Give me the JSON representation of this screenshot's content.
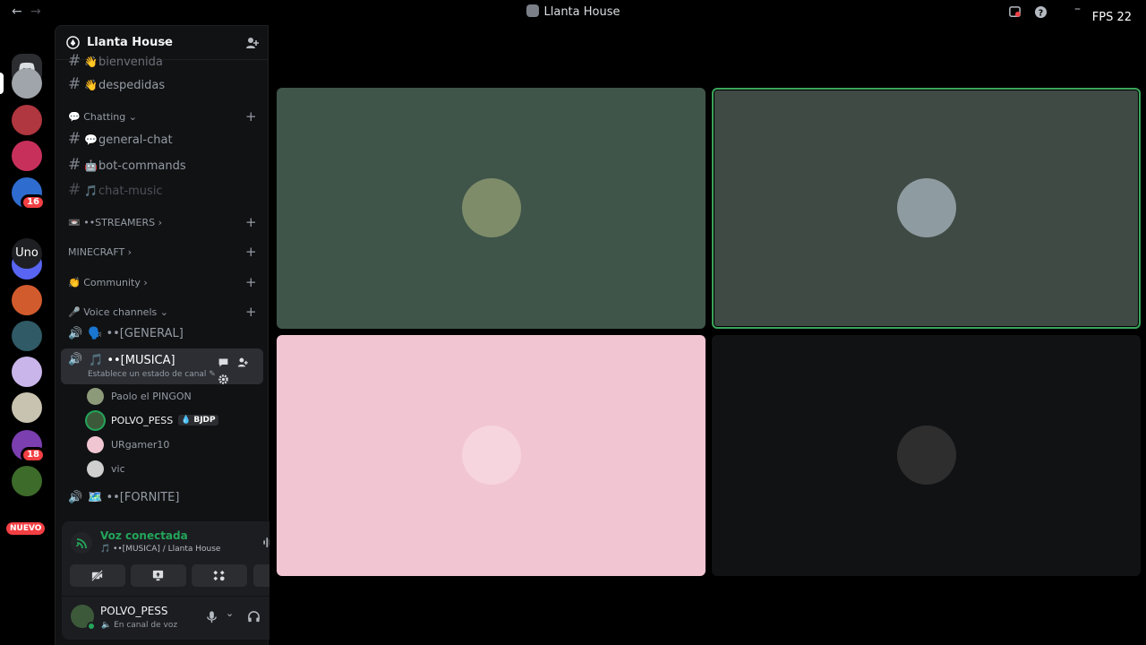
{
  "titlebar": {
    "title": "Llanta House",
    "fps": "FPS 22"
  },
  "rail": {
    "servers": [
      {
        "name": "server-1",
        "color": "#a0a4ab",
        "badge": ""
      },
      {
        "name": "server-2",
        "color": "#b0363f",
        "badge": ""
      },
      {
        "name": "server-3",
        "color": "#c8305c",
        "badge": ""
      },
      {
        "name": "server-4",
        "color": "#2f6ccf",
        "badge": "16"
      },
      {
        "name": "server-6",
        "color": "#5865f2",
        "badge": ""
      },
      {
        "name": "server-7",
        "color": "#d25b2e",
        "badge": ""
      },
      {
        "name": "server-8",
        "color": "#2f5a66",
        "badge": ""
      },
      {
        "name": "server-9",
        "color": "#c9b5ea",
        "badge": ""
      },
      {
        "name": "server-10",
        "color": "#c8c2b0",
        "badge": ""
      },
      {
        "name": "server-11",
        "color": "#7b3fb0",
        "badge": "18"
      },
      {
        "name": "server-12",
        "color": "#3d6b2a",
        "badge": ""
      }
    ],
    "uno_label": "Uno",
    "new_label": "NUEVO"
  },
  "sidebar": {
    "server_name": "Llanta House",
    "partial_channel": "bienvenida",
    "channels_top": [
      {
        "emoji": "👋",
        "name": "despedidas"
      }
    ],
    "chatting": {
      "label": "Chatting",
      "emoji": "💬",
      "channels": [
        {
          "emoji": "💬",
          "name": "general-chat"
        },
        {
          "emoji": "🤖",
          "name": "bot-commands"
        },
        {
          "emoji": "🎵",
          "name": "chat-music"
        }
      ]
    },
    "categories": [
      {
        "emoji": "📼",
        "label": "••STREAMERS"
      },
      {
        "emoji": "",
        "label": "MINECRAFT"
      },
      {
        "emoji": "👏",
        "label": "Community"
      }
    ],
    "voice": {
      "label": "Voice channels",
      "emoji": "🎤",
      "general": "🗣️ ••[GENERAL]",
      "active_channel": "🎵 ••[MUSICA]",
      "active_status": "Establece un estado de canal",
      "members": [
        {
          "name": "Paolo el PINGON",
          "color": "#8d9a7a",
          "tag": ""
        },
        {
          "name": "POLVO_PESS",
          "color": "#3c5a3a",
          "tag": "BJDP"
        },
        {
          "name": "URgamer10",
          "color": "#f1c6d3",
          "tag": ""
        },
        {
          "name": "vic",
          "color": "#cfcfcf",
          "tag": ""
        }
      ],
      "fornite": "🗺️ ••[FORNITE]"
    }
  },
  "voice_panel": {
    "title": "Voz conectada",
    "subtitle": "🎵 ••[MUSICA] / Llanta House",
    "user_name": "POLVO_PESS",
    "user_status": "En canal de voz"
  },
  "stage": {
    "tiles": [
      {
        "name": "tile-paolo",
        "bg": "#3f5549",
        "avatar": "#7e8c6a",
        "speaking": false
      },
      {
        "name": "tile-polvo",
        "bg": "#3e4a43",
        "avatar": "#8e9ba0",
        "speaking": true
      },
      {
        "name": "tile-urgamer",
        "bg": "#f2c5d3",
        "avatar": "#f6d5de",
        "speaking": false
      },
      {
        "name": "tile-vic",
        "bg": "#111214",
        "avatar": "#2e2e2e",
        "speaking": false
      }
    ]
  }
}
